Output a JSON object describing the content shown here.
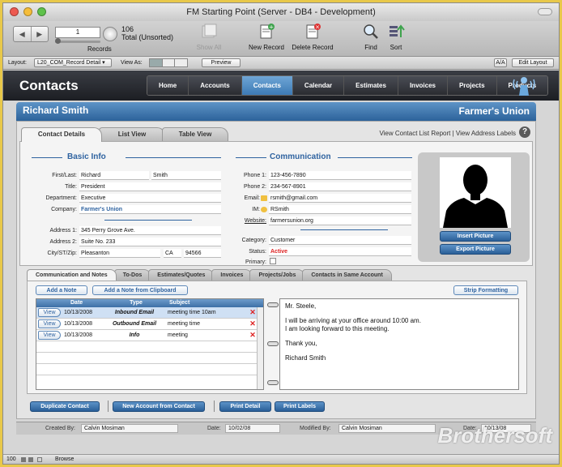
{
  "window": {
    "title": "FM Starting Point (Server - DB4 - Development)"
  },
  "toolbar": {
    "record_input": "1",
    "record_total": "106",
    "record_status": "Total (Unsorted)",
    "records_label": "Records",
    "show_all": "Show All",
    "new_record": "New Record",
    "delete_record": "Delete Record",
    "find": "Find",
    "sort": "Sort"
  },
  "layoutbar": {
    "layout_label": "Layout:",
    "layout_value": "L20_COM_Record Detail",
    "view_as_label": "View As:",
    "preview": "Preview",
    "aa": "A/A",
    "edit_layout": "Edit Layout"
  },
  "app": {
    "title": "Contacts",
    "nav": [
      "Home",
      "Accounts",
      "Contacts",
      "Calendar",
      "Estimates",
      "Invoices",
      "Projects",
      "Products"
    ],
    "nav_active": "Contacts"
  },
  "record": {
    "name": "Richard Smith",
    "company_header": "Farmer's Union"
  },
  "tabs": {
    "top": [
      "Contact Details",
      "List View",
      "Table View"
    ],
    "links": "View Contact List Report | View Address Labels",
    "help": "?"
  },
  "basic_info": {
    "heading": "Basic Info",
    "first_last_label": "First/Last:",
    "first": "Richard",
    "last": "Smith",
    "title_label": "Title:",
    "title": "President",
    "department_label": "Department:",
    "department": "Executive",
    "company_label": "Company:",
    "company": "Farmer's Union",
    "address1_label": "Address 1:",
    "address1": "345 Perry Grove Ave.",
    "address2_label": "Address 2:",
    "address2": "Suite No. 233",
    "city_label": "City/ST/Zip:",
    "city": "Pleasanton",
    "state": "CA",
    "zip": "94566"
  },
  "communication": {
    "heading": "Communication",
    "phone1_label": "Phone 1:",
    "phone1": "123-456-7890",
    "phone2_label": "Phone 2:",
    "phone2": "234-567-8901",
    "email_label": "Email:",
    "email": "rsmith@gmail.com",
    "im_label": "IM:",
    "im": "RSmith",
    "website_label": "Website:",
    "website": "farmersunion.org",
    "category_label": "Category:",
    "category": "Customer",
    "status_label": "Status:",
    "status": "Active",
    "primary_label": "Primary:"
  },
  "photo": {
    "insert": "Insert Picture",
    "export": "Export Picture"
  },
  "lower_tabs": [
    "Communication and Notes",
    "To-Dos",
    "Estimates/Quotes",
    "Invoices",
    "Projects/Jobs",
    "Contacts in Same Account"
  ],
  "notes": {
    "add_note": "Add a Note",
    "add_clipboard": "Add a Note from Clipboard",
    "strip": "Strip Formatting",
    "columns": [
      "Date",
      "Type",
      "Subject"
    ],
    "rows": [
      {
        "view": "View",
        "date": "10/13/2008",
        "type": "Inbound Email",
        "subject": "meeting time 10am"
      },
      {
        "view": "View",
        "date": "10/13/2008",
        "type": "Outbound Email",
        "subject": "meeting time"
      },
      {
        "view": "View",
        "date": "10/13/2008",
        "type": "Info",
        "subject": "meeting"
      }
    ],
    "body": {
      "greeting": "Mr. Steele,",
      "line1": "I will be arriving at your office around 10:00 am.",
      "line2": "I am looking forward to this meeting.",
      "closing": "Thank you,",
      "signature": "Richard Smith"
    }
  },
  "actions": {
    "duplicate": "Duplicate Contact",
    "new_account": "New Account from Contact",
    "print_detail": "Print Detail",
    "print_labels": "Print Labels"
  },
  "footer": {
    "created_by_label": "Created By:",
    "created_by": "Calvin Mosiman",
    "date_label": "Date:",
    "created_date": "10/02/08",
    "modified_label": "Modified By:",
    "modified_by": "Calvin Mosiman",
    "date2_label": "Date:",
    "modified_date": "10/13/08"
  },
  "status": {
    "zoom": "100",
    "mode": "Browse"
  },
  "watermark": "Brothersoft"
}
